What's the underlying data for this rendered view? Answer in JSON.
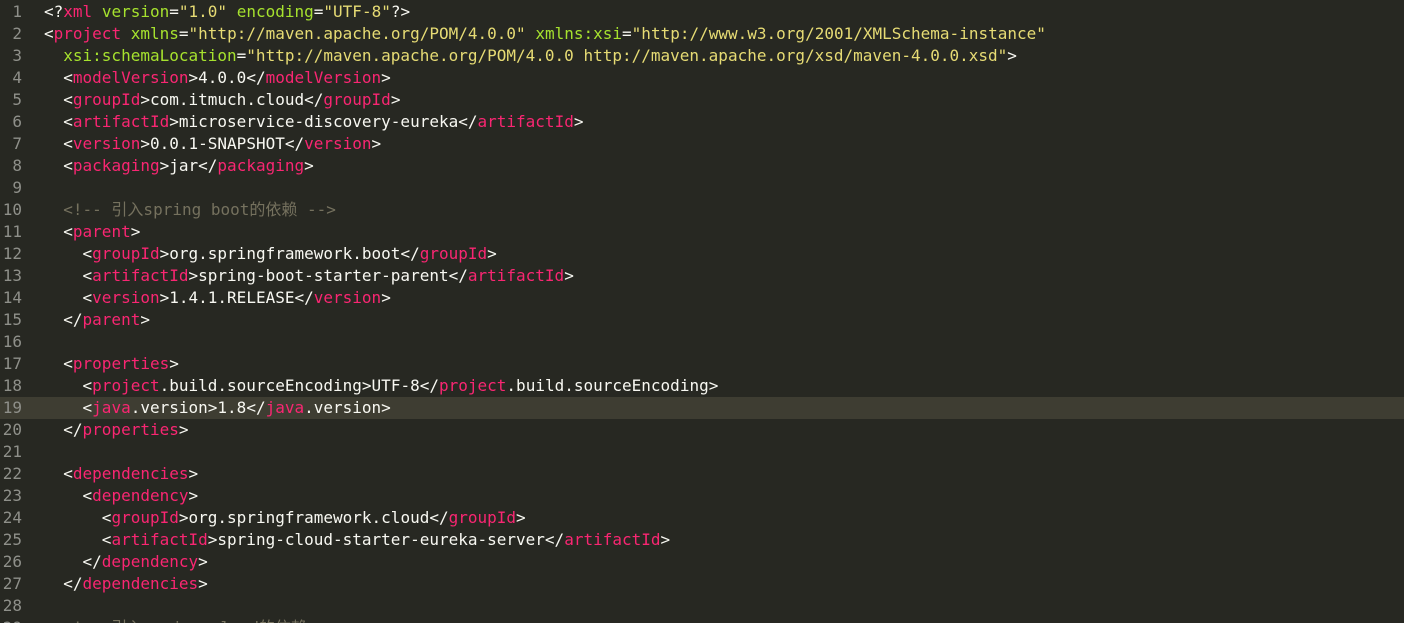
{
  "editor": {
    "theme_colors": {
      "background": "#272822",
      "current_line": "#3e3d32",
      "gutter_text": "#8f908a",
      "text": "#f8f8f2",
      "tag": "#f92672",
      "attr": "#a6e22e",
      "string": "#e6db74",
      "comment": "#75715e"
    },
    "current_line_number": 19,
    "lines": [
      {
        "n": "1",
        "tokens": [
          [
            "punct",
            "<?"
          ],
          [
            "tag",
            "xml"
          ],
          [
            "text",
            " "
          ],
          [
            "attr",
            "version"
          ],
          [
            "op",
            "="
          ],
          [
            "str",
            "\"1.0\""
          ],
          [
            "text",
            " "
          ],
          [
            "attr",
            "encoding"
          ],
          [
            "op",
            "="
          ],
          [
            "str",
            "\"UTF-8\""
          ],
          [
            "punct",
            "?>"
          ]
        ]
      },
      {
        "n": "2",
        "tokens": [
          [
            "punct",
            "<"
          ],
          [
            "tag",
            "project"
          ],
          [
            "text",
            " "
          ],
          [
            "attr",
            "xmlns"
          ],
          [
            "op",
            "="
          ],
          [
            "str",
            "\"http://maven.apache.org/POM/4.0.0\""
          ],
          [
            "text",
            " "
          ],
          [
            "attr",
            "xmlns:xsi"
          ],
          [
            "op",
            "="
          ],
          [
            "str",
            "\"http://www.w3.org/2001/XMLSchema-instance\""
          ]
        ]
      },
      {
        "n": "3",
        "tokens": [
          [
            "text",
            "  "
          ],
          [
            "attr",
            "xsi:schemaLocation"
          ],
          [
            "op",
            "="
          ],
          [
            "str",
            "\"http://maven.apache.org/POM/4.0.0 http://maven.apache.org/xsd/maven-4.0.0.xsd\""
          ],
          [
            "punct",
            ">"
          ]
        ]
      },
      {
        "n": "4",
        "tokens": [
          [
            "text",
            "  "
          ],
          [
            "punct",
            "<"
          ],
          [
            "tag",
            "modelVersion"
          ],
          [
            "punct",
            ">"
          ],
          [
            "text",
            "4.0.0"
          ],
          [
            "punct",
            "</"
          ],
          [
            "tag",
            "modelVersion"
          ],
          [
            "punct",
            ">"
          ]
        ]
      },
      {
        "n": "5",
        "tokens": [
          [
            "text",
            "  "
          ],
          [
            "punct",
            "<"
          ],
          [
            "tag",
            "groupId"
          ],
          [
            "punct",
            ">"
          ],
          [
            "text",
            "com.itmuch.cloud"
          ],
          [
            "punct",
            "</"
          ],
          [
            "tag",
            "groupId"
          ],
          [
            "punct",
            ">"
          ]
        ]
      },
      {
        "n": "6",
        "tokens": [
          [
            "text",
            "  "
          ],
          [
            "punct",
            "<"
          ],
          [
            "tag",
            "artifactId"
          ],
          [
            "punct",
            ">"
          ],
          [
            "text",
            "microservice-discovery-eureka"
          ],
          [
            "punct",
            "</"
          ],
          [
            "tag",
            "artifactId"
          ],
          [
            "punct",
            ">"
          ]
        ]
      },
      {
        "n": "7",
        "tokens": [
          [
            "text",
            "  "
          ],
          [
            "punct",
            "<"
          ],
          [
            "tag",
            "version"
          ],
          [
            "punct",
            ">"
          ],
          [
            "text",
            "0.0.1-SNAPSHOT"
          ],
          [
            "punct",
            "</"
          ],
          [
            "tag",
            "version"
          ],
          [
            "punct",
            ">"
          ]
        ]
      },
      {
        "n": "8",
        "tokens": [
          [
            "text",
            "  "
          ],
          [
            "punct",
            "<"
          ],
          [
            "tag",
            "packaging"
          ],
          [
            "punct",
            ">"
          ],
          [
            "text",
            "jar"
          ],
          [
            "punct",
            "</"
          ],
          [
            "tag",
            "packaging"
          ],
          [
            "punct",
            ">"
          ]
        ]
      },
      {
        "n": "9",
        "tokens": []
      },
      {
        "n": "10",
        "tokens": [
          [
            "text",
            "  "
          ],
          [
            "cmt",
            "<!-- 引入spring boot的依赖 -->"
          ]
        ]
      },
      {
        "n": "11",
        "tokens": [
          [
            "text",
            "  "
          ],
          [
            "punct",
            "<"
          ],
          [
            "tag",
            "parent"
          ],
          [
            "punct",
            ">"
          ]
        ]
      },
      {
        "n": "12",
        "tokens": [
          [
            "text",
            "    "
          ],
          [
            "punct",
            "<"
          ],
          [
            "tag",
            "groupId"
          ],
          [
            "punct",
            ">"
          ],
          [
            "text",
            "org.springframework.boot"
          ],
          [
            "punct",
            "</"
          ],
          [
            "tag",
            "groupId"
          ],
          [
            "punct",
            ">"
          ]
        ]
      },
      {
        "n": "13",
        "tokens": [
          [
            "text",
            "    "
          ],
          [
            "punct",
            "<"
          ],
          [
            "tag",
            "artifactId"
          ],
          [
            "punct",
            ">"
          ],
          [
            "text",
            "spring-boot-starter-parent"
          ],
          [
            "punct",
            "</"
          ],
          [
            "tag",
            "artifactId"
          ],
          [
            "punct",
            ">"
          ]
        ]
      },
      {
        "n": "14",
        "tokens": [
          [
            "text",
            "    "
          ],
          [
            "punct",
            "<"
          ],
          [
            "tag",
            "version"
          ],
          [
            "punct",
            ">"
          ],
          [
            "text",
            "1.4.1.RELEASE"
          ],
          [
            "punct",
            "</"
          ],
          [
            "tag",
            "version"
          ],
          [
            "punct",
            ">"
          ]
        ]
      },
      {
        "n": "15",
        "tokens": [
          [
            "text",
            "  "
          ],
          [
            "punct",
            "</"
          ],
          [
            "tag",
            "parent"
          ],
          [
            "punct",
            ">"
          ]
        ]
      },
      {
        "n": "16",
        "tokens": []
      },
      {
        "n": "17",
        "tokens": [
          [
            "text",
            "  "
          ],
          [
            "punct",
            "<"
          ],
          [
            "tag",
            "properties"
          ],
          [
            "punct",
            ">"
          ]
        ]
      },
      {
        "n": "18",
        "tokens": [
          [
            "text",
            "    "
          ],
          [
            "punct",
            "<"
          ],
          [
            "tag",
            "project"
          ],
          [
            "text",
            ".build.sourceEncoding"
          ],
          [
            "punct",
            ">"
          ],
          [
            "text",
            "UTF-8"
          ],
          [
            "punct",
            "</"
          ],
          [
            "tag",
            "project"
          ],
          [
            "text",
            ".build.sourceEncoding"
          ],
          [
            "punct",
            ">"
          ]
        ]
      },
      {
        "n": "19",
        "tokens": [
          [
            "text",
            "    "
          ],
          [
            "punct",
            "<"
          ],
          [
            "tag",
            "java"
          ],
          [
            "text",
            ".version"
          ],
          [
            "punct",
            ">"
          ],
          [
            "text",
            "1.8"
          ],
          [
            "punct",
            "</"
          ],
          [
            "tag",
            "java"
          ],
          [
            "text",
            ".version"
          ],
          [
            "punct",
            ">"
          ]
        ]
      },
      {
        "n": "20",
        "tokens": [
          [
            "text",
            "  "
          ],
          [
            "punct",
            "</"
          ],
          [
            "tag",
            "properties"
          ],
          [
            "punct",
            ">"
          ]
        ]
      },
      {
        "n": "21",
        "tokens": []
      },
      {
        "n": "22",
        "tokens": [
          [
            "text",
            "  "
          ],
          [
            "punct",
            "<"
          ],
          [
            "tag",
            "dependencies"
          ],
          [
            "punct",
            ">"
          ]
        ]
      },
      {
        "n": "23",
        "tokens": [
          [
            "text",
            "    "
          ],
          [
            "punct",
            "<"
          ],
          [
            "tag",
            "dependency"
          ],
          [
            "punct",
            ">"
          ]
        ]
      },
      {
        "n": "24",
        "tokens": [
          [
            "text",
            "      "
          ],
          [
            "punct",
            "<"
          ],
          [
            "tag",
            "groupId"
          ],
          [
            "punct",
            ">"
          ],
          [
            "text",
            "org.springframework.cloud"
          ],
          [
            "punct",
            "</"
          ],
          [
            "tag",
            "groupId"
          ],
          [
            "punct",
            ">"
          ]
        ]
      },
      {
        "n": "25",
        "tokens": [
          [
            "text",
            "      "
          ],
          [
            "punct",
            "<"
          ],
          [
            "tag",
            "artifactId"
          ],
          [
            "punct",
            ">"
          ],
          [
            "text",
            "spring-cloud-starter-eureka-server"
          ],
          [
            "punct",
            "</"
          ],
          [
            "tag",
            "artifactId"
          ],
          [
            "punct",
            ">"
          ]
        ]
      },
      {
        "n": "26",
        "tokens": [
          [
            "text",
            "    "
          ],
          [
            "punct",
            "</"
          ],
          [
            "tag",
            "dependency"
          ],
          [
            "punct",
            ">"
          ]
        ]
      },
      {
        "n": "27",
        "tokens": [
          [
            "text",
            "  "
          ],
          [
            "punct",
            "</"
          ],
          [
            "tag",
            "dependencies"
          ],
          [
            "punct",
            ">"
          ]
        ]
      },
      {
        "n": "28",
        "tokens": []
      },
      {
        "n": "29",
        "tokens": [
          [
            "text",
            "  "
          ],
          [
            "cmt",
            "<!-- 引入spring cloud的依赖 -->"
          ]
        ]
      }
    ]
  }
}
